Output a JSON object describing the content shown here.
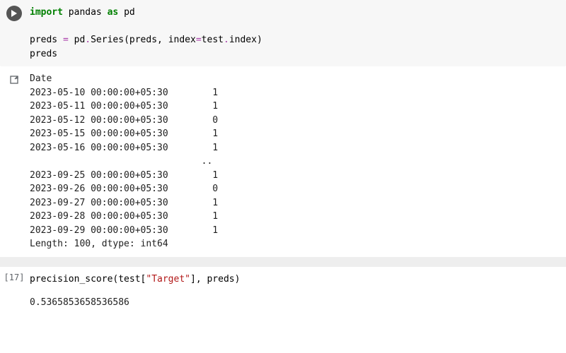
{
  "cell1": {
    "code": {
      "kw_import": "import",
      "mod_pandas": "pandas",
      "kw_as": "as",
      "alias_pd": "pd",
      "lhs": "preds",
      "eq": "=",
      "pd": "pd",
      "dot1": ".",
      "series": "Series",
      "op_paren_open": "(",
      "arg_preds": "preds",
      "comma1": ",",
      "kw_index": "index",
      "eq2": "=",
      "test": "test",
      "dot2": ".",
      "index_attr": "index",
      "op_paren_close": ")",
      "expr_preds": "preds"
    },
    "output_header": "Date",
    "output_rows": [
      {
        "idx": "2023-05-10 00:00:00+05:30",
        "val": "1"
      },
      {
        "idx": "2023-05-11 00:00:00+05:30",
        "val": "1"
      },
      {
        "idx": "2023-05-12 00:00:00+05:30",
        "val": "0"
      },
      {
        "idx": "2023-05-15 00:00:00+05:30",
        "val": "1"
      },
      {
        "idx": "2023-05-16 00:00:00+05:30",
        "val": "1"
      }
    ],
    "output_ellipsis": "..",
    "output_rows_tail": [
      {
        "idx": "2023-09-25 00:00:00+05:30",
        "val": "1"
      },
      {
        "idx": "2023-09-26 00:00:00+05:30",
        "val": "0"
      },
      {
        "idx": "2023-09-27 00:00:00+05:30",
        "val": "1"
      },
      {
        "idx": "2023-09-28 00:00:00+05:30",
        "val": "1"
      },
      {
        "idx": "2023-09-29 00:00:00+05:30",
        "val": "1"
      }
    ],
    "output_footer": "Length: 100, dtype: int64"
  },
  "cell2": {
    "prompt": "[17]",
    "code": {
      "fn": "precision_score",
      "op_paren_open": "(",
      "test": "test",
      "br_open": "[",
      "str_target": "\"Target\"",
      "br_close": "]",
      "comma": ",",
      "preds": "preds",
      "op_paren_close": ")"
    },
    "output": "0.5365853658536586"
  }
}
